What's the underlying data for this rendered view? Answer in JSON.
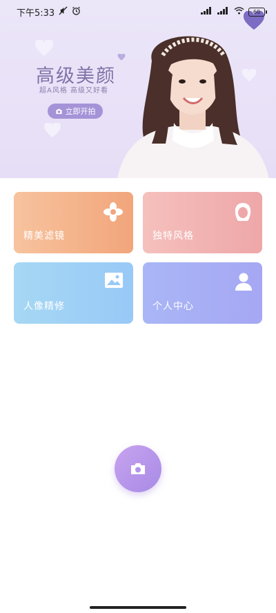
{
  "status_bar": {
    "time": "下午5:33",
    "battery": "60"
  },
  "banner": {
    "title": "高级美颜",
    "subtitle": "超A风格 高级又好看",
    "shoot_button": "立即开拍"
  },
  "features": [
    {
      "label": "精美滤镜",
      "icon": "flower-icon"
    },
    {
      "label": "独特风格",
      "icon": "hair-style-icon"
    },
    {
      "label": "人像精修",
      "icon": "image-icon"
    },
    {
      "label": "个人中心",
      "icon": "person-icon"
    }
  ],
  "colors": {
    "accent": "#a88be6",
    "banner_bg": "#ece6f9"
  }
}
